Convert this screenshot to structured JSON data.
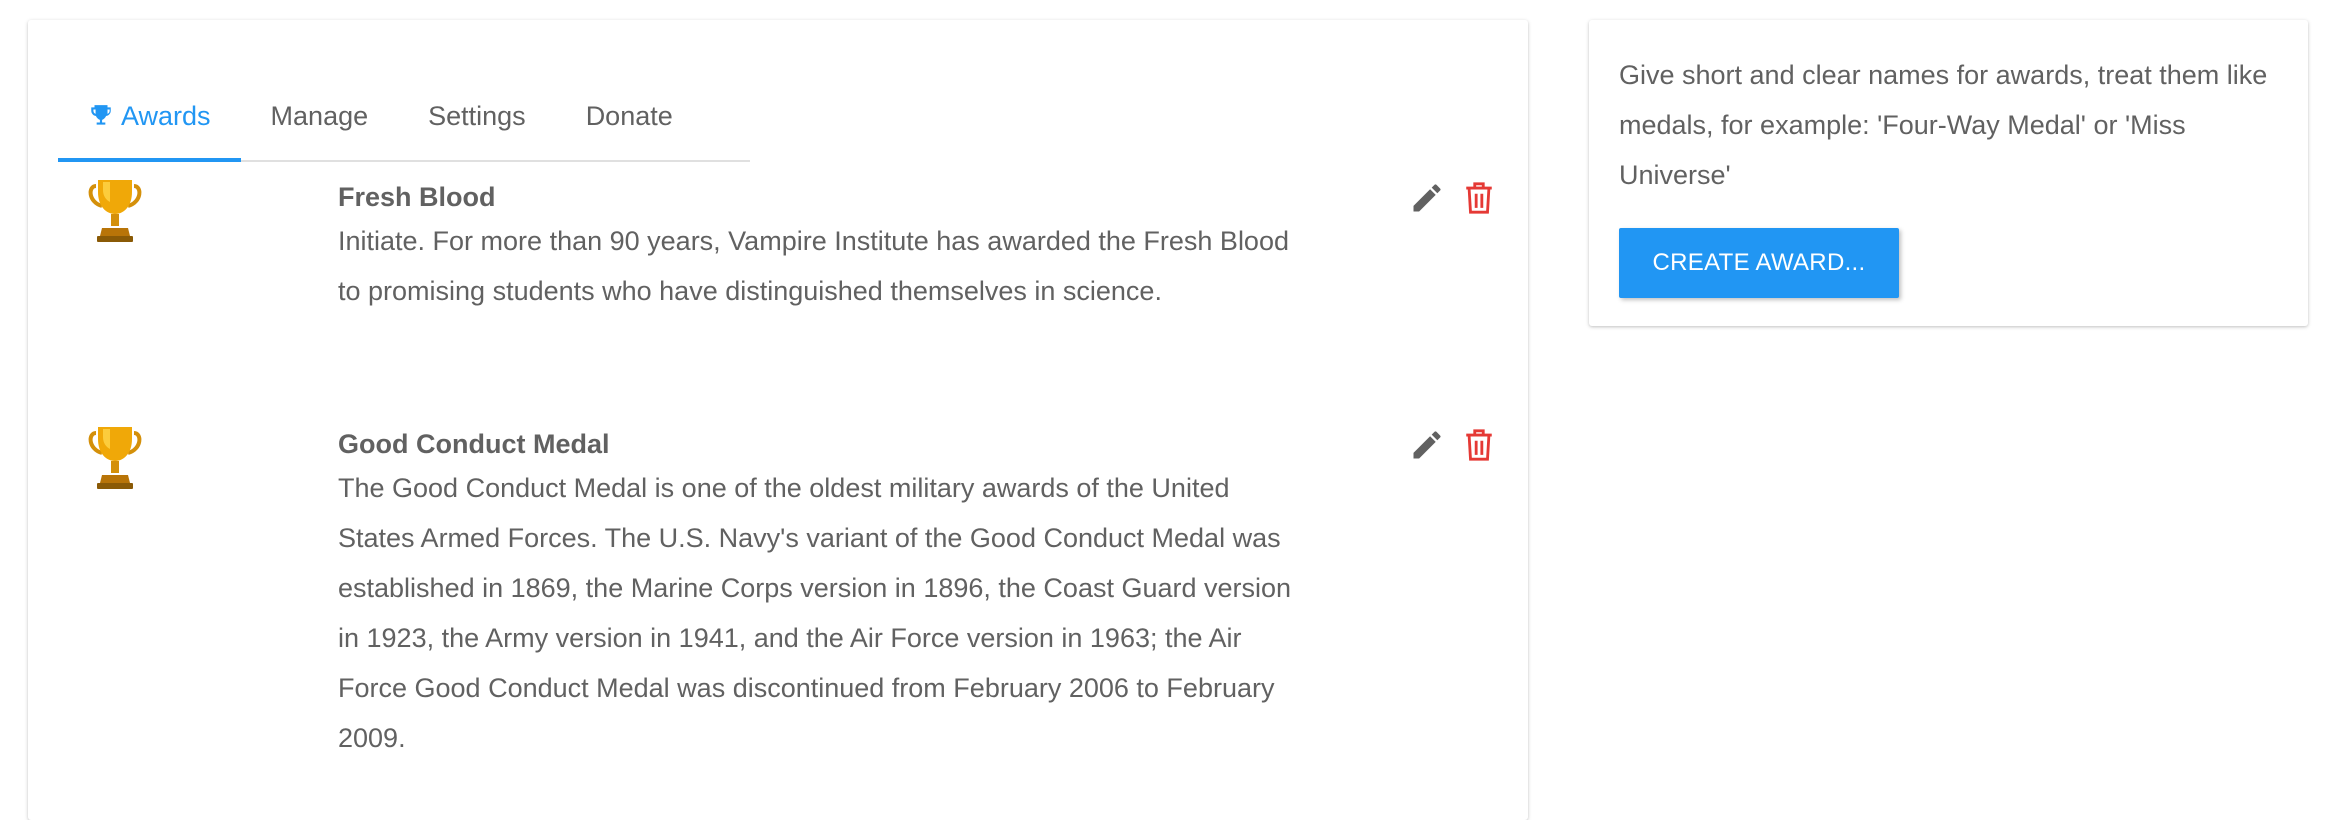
{
  "tabs": [
    {
      "label": "Awards",
      "icon": "trophy-icon",
      "active": true
    },
    {
      "label": "Manage",
      "active": false
    },
    {
      "label": "Settings",
      "active": false
    },
    {
      "label": "Donate",
      "active": false
    }
  ],
  "awards": [
    {
      "title": "Fresh Blood",
      "description": "Initiate. For more than 90 years, Vampire Institute has awarded the Fresh Blood to promising students who have distinguished themselves in science.",
      "icon": "trophy-icon"
    },
    {
      "title": "Good Conduct Medal",
      "description": "The Good Conduct Medal is one of the oldest military awards of the United States Armed Forces. The U.S. Navy's variant of the Good Conduct Medal was established in 1869, the Marine Corps version in 1896, the Coast Guard version in 1923, the Army version in 1941, and the Air Force version in 1963; the Air Force Good Conduct Medal was discontinued from February 2006 to February 2009.",
      "icon": "trophy-icon"
    }
  ],
  "actions": {
    "edit_icon": "pencil-icon",
    "delete_icon": "trash-icon"
  },
  "sidebar": {
    "help_text": "Give short and clear names for awards, treat them like medals, for example: 'Four-Way Medal' or 'Miss Universe'",
    "create_button_label": "CREATE AWARD..."
  },
  "colors": {
    "accent": "#2196f3",
    "delete": "#e53935",
    "text": "#616161",
    "trophy": "#f0a808"
  }
}
